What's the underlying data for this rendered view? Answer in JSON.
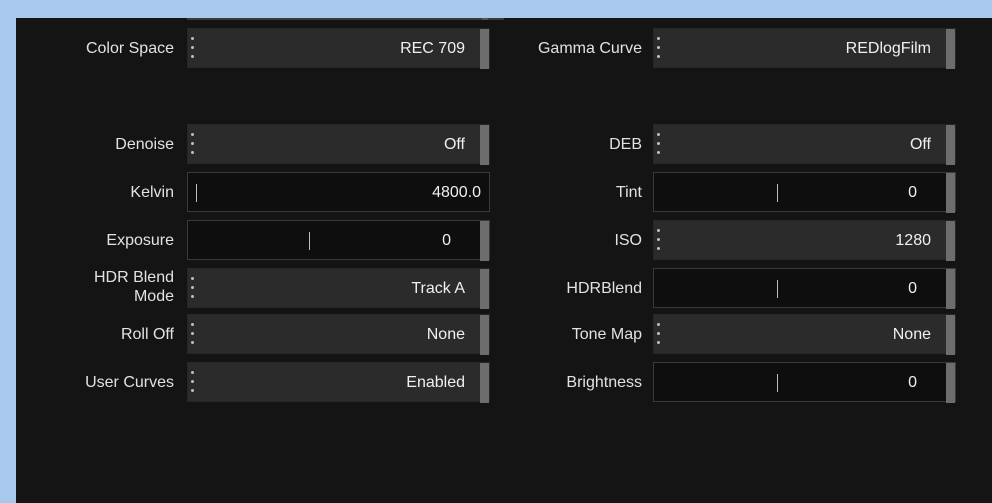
{
  "left": [
    {
      "label": "Color Space",
      "value": "REC 709",
      "kind": "dropdown"
    },
    {
      "label": "Denoise",
      "value": "Off",
      "kind": "dropdown"
    },
    {
      "label": "Kelvin",
      "value": "4800.0",
      "kind": "slider-left"
    },
    {
      "label": "Exposure",
      "value": "0",
      "kind": "slider-center"
    },
    {
      "label_line1": "HDR Blend",
      "label_line2": "Mode",
      "value": "Track A",
      "kind": "dropdown"
    },
    {
      "label": "Roll Off",
      "value": "None",
      "kind": "dropdown"
    },
    {
      "label": "User Curves",
      "value": "Enabled",
      "kind": "dropdown"
    }
  ],
  "right": [
    {
      "label": "Gamma Curve",
      "value": "REDlogFilm",
      "kind": "dropdown"
    },
    {
      "label": "DEB",
      "value": "Off",
      "kind": "dropdown"
    },
    {
      "label": "Tint",
      "value": "0",
      "kind": "slider-center"
    },
    {
      "label": "ISO",
      "value": "1280",
      "kind": "dropdown"
    },
    {
      "label": "HDRBlend",
      "value": "0",
      "kind": "slider-center"
    },
    {
      "label": "Tone Map",
      "value": "None",
      "kind": "dropdown"
    },
    {
      "label": "Brightness",
      "value": "0",
      "kind": "slider-center"
    }
  ],
  "colors": {
    "page_bg": "#a9c8ee",
    "panel_bg": "#141414",
    "control_bg": "#2b2b2b",
    "text": "#e2e2e2"
  }
}
